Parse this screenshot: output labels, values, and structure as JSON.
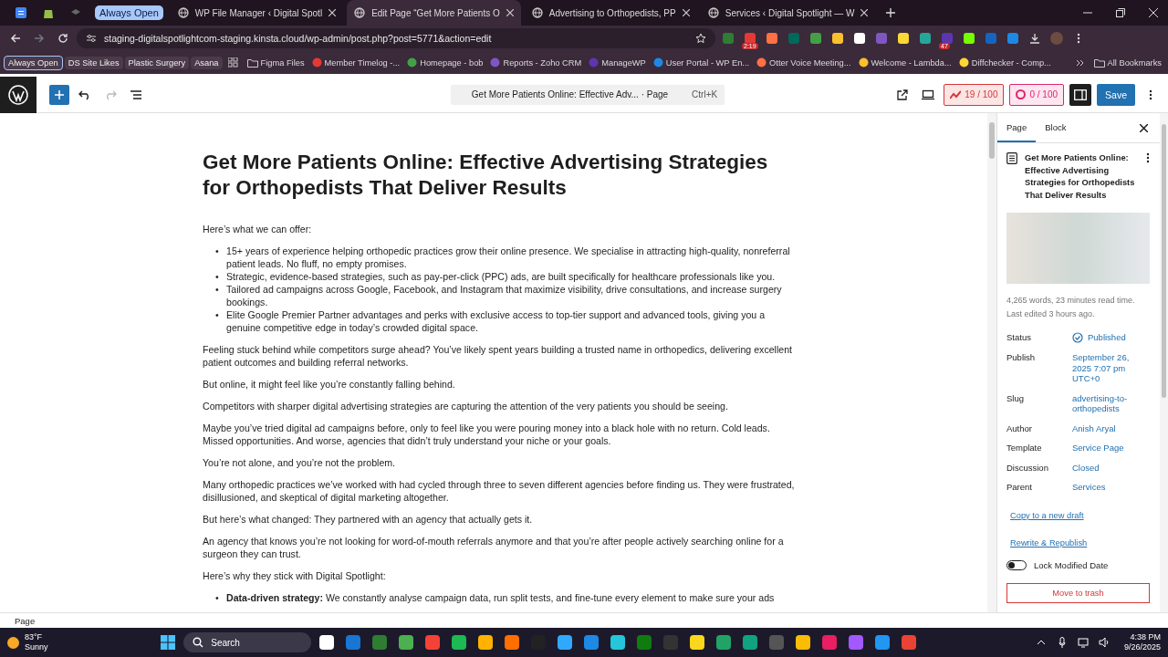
{
  "browser": {
    "tab_group": "Always Open",
    "tabs": [
      {
        "title": "WP File Manager ‹ Digital Spotl",
        "selected": false
      },
      {
        "title": "Edit Page “Get More Patients O",
        "selected": true
      },
      {
        "title": "Advertising to Orthopedists, PP",
        "selected": false
      },
      {
        "title": "Services ‹ Digital Spotlight — W",
        "selected": false
      }
    ],
    "url": "staging-digitalspotlightcom-staging.kinsta.cloud/wp-admin/post.php?post=5771&action=edit",
    "extension_badges": [
      "2:19",
      "47"
    ],
    "bookmarks": [
      {
        "label": "Always Open",
        "kind": "chip"
      },
      {
        "label": "DS Site Likes",
        "kind": "chip"
      },
      {
        "label": "Plastic Surgery",
        "kind": "chip"
      },
      {
        "label": "Asana",
        "kind": "chip"
      },
      {
        "label": "Figma Files",
        "kind": "folder"
      },
      {
        "label": "Member Timelog -...",
        "kind": "link"
      },
      {
        "label": "Homepage - bob",
        "kind": "link"
      },
      {
        "label": "Reports - Zoho CRM",
        "kind": "link"
      },
      {
        "label": "ManageWP",
        "kind": "link"
      },
      {
        "label": "User Portal - WP En...",
        "kind": "link"
      },
      {
        "label": "Otter Voice Meeting...",
        "kind": "link"
      },
      {
        "label": "Welcome - Lambda...",
        "kind": "link"
      },
      {
        "label": "Diffchecker - Comp...",
        "kind": "link"
      }
    ],
    "all_bookmarks": "All Bookmarks"
  },
  "toolbar": {
    "command": "Get More Patients Online: Effective Adv... · Page",
    "shortcut": "Ctrl+K",
    "scores": [
      "19 / 100",
      "0 / 100"
    ],
    "save": "Save"
  },
  "document": {
    "title": "Get More Patients Online: Effective Advertising Strategies for Orthopedists That Deliver Results",
    "blocks": [
      {
        "kind": "paragraph",
        "text": "Here’s what we can offer:"
      },
      {
        "kind": "list",
        "marker": "•",
        "items": [
          "15+ years of experience helping orthopedic practices grow their online presence. We specialise in attracting high-quality, nonreferral patient leads. No fluff, no empty promises.",
          "Strategic, evidence-based strategies, such as pay-per-click (PPC) ads, are built specifically for healthcare professionals like you.",
          "Tailored ad campaigns across Google, Facebook, and Instagram that maximize visibility, drive consultations, and increase surgery bookings.",
          "Elite Google Premier Partner advantages and perks with exclusive access to top-tier support and advanced tools, giving you a genuine competitive edge in today’s crowded digital space."
        ]
      },
      {
        "kind": "paragraph",
        "text": "Feeling stuck behind while competitors surge ahead? You’ve likely spent years building a trusted name in orthopedics, delivering excellent patient outcomes and building referral networks."
      },
      {
        "kind": "paragraph",
        "text": "But online, it might feel like you’re constantly falling behind."
      },
      {
        "kind": "paragraph",
        "text": "Competitors with sharper digital advertising strategies are capturing the attention of the very patients you should be seeing."
      },
      {
        "kind": "paragraph",
        "text": "Maybe you’ve tried digital ad campaigns before, only to feel like you were pouring money into a black hole with no return. Cold leads. Missed opportunities. And worse, agencies that didn’t truly understand your niche or your goals."
      },
      {
        "kind": "paragraph",
        "text": "You’re not alone, and you’re not the problem."
      },
      {
        "kind": "paragraph",
        "text": "Many orthopedic practices we’ve worked with had cycled through three to seven different agencies before finding us. They were frustrated, disillusioned, and skeptical of digital marketing altogether."
      },
      {
        "kind": "paragraph",
        "text": "But here’s what changed: They partnered with an agency that actually gets it."
      },
      {
        "kind": "paragraph",
        "text": "An agency that knows you’re not looking for word-of-mouth referrals anymore and that you’re after people actively searching online for a surgeon they can trust."
      },
      {
        "kind": "paragraph",
        "text": "Here’s why they stick with Digital Spotlight:"
      },
      {
        "kind": "list",
        "marker": "•",
        "items": [
          "**Data-driven strategy:** We constantly analyse campaign data, run split tests, and fine-tune every element to make sure your ads"
        ]
      }
    ]
  },
  "sidebar": {
    "tabs": [
      {
        "label": "Page",
        "selected": true
      },
      {
        "label": "Block",
        "selected": false
      }
    ],
    "title": "Get More Patients Online: Effective Advertising Strategies for Orthopedists That Deliver Results",
    "stats": "4,265 words, 23 minutes read time.",
    "edited": "Last edited 3 hours ago.",
    "fields": [
      {
        "label": "Status",
        "value": "Published",
        "kind": "status"
      },
      {
        "label": "Publish",
        "value": "September 26, 2025 7:07 pm UTC+0",
        "kind": "link"
      },
      {
        "label": "Slug",
        "value": "advertising-to-orthopedists",
        "kind": "link"
      },
      {
        "label": "Author",
        "value": "Anish Aryal",
        "kind": "link"
      },
      {
        "label": "Template",
        "value": "Service Page",
        "kind": "link"
      },
      {
        "label": "Discussion",
        "value": "Closed",
        "kind": "link"
      },
      {
        "label": "Parent",
        "value": "Services",
        "kind": "link"
      }
    ],
    "links": [
      "Copy to a new draft",
      "Rewrite & Republish"
    ],
    "lock": {
      "label": "Lock Modified Date",
      "on": false
    },
    "trash": "Move to trash"
  },
  "footer": "Page",
  "taskbar": {
    "temperature": "83°F",
    "weather": "Sunny",
    "search": "Search",
    "time": "4:38 PM",
    "date": "9/26/2025"
  }
}
